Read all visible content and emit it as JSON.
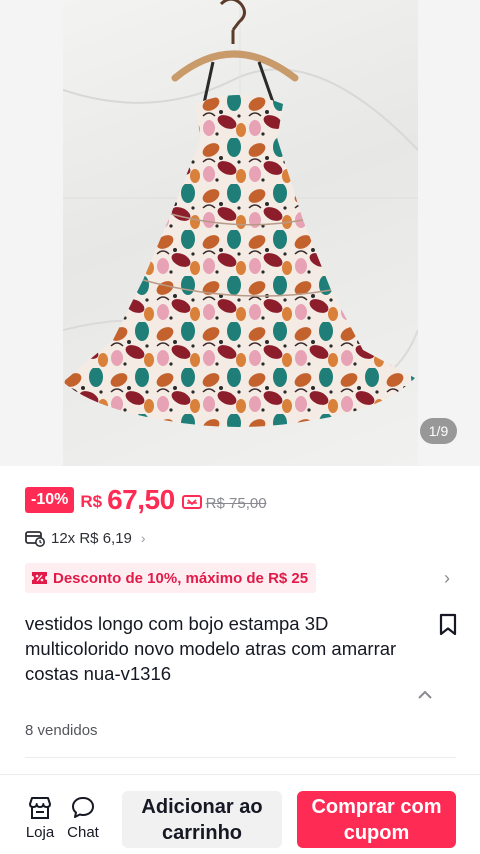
{
  "gallery": {
    "counter": "1/9",
    "image_alt": "product-photo-dress"
  },
  "price": {
    "discount_badge": "-10%",
    "currency": "R$",
    "current": "67,50",
    "original": "R$ 75,00",
    "icon": "coupon-icon"
  },
  "installment": {
    "icon": "card-clock-icon",
    "text": "12x R$ 6,19",
    "chevron": "›"
  },
  "promo": {
    "icon": "coupon-ticket-icon",
    "text": "Desconto de 10%, máximo de R$ 25",
    "arrow": "›"
  },
  "product": {
    "title": "vestidos longo  com bojo estampa 3D multicolorido novo modelo atras com amarrar costas nua-v1316",
    "sold": "8 vendidos"
  },
  "bottom_bar": {
    "store_label": "Loja",
    "chat_label": "Chat",
    "cart_button": "Adicionar ao carrinho",
    "buy_button": "Comprar com cupom"
  },
  "colors": {
    "accent": "#fe2c55",
    "promo_bg": "#ffeef1",
    "promo_text": "#e21a49"
  }
}
